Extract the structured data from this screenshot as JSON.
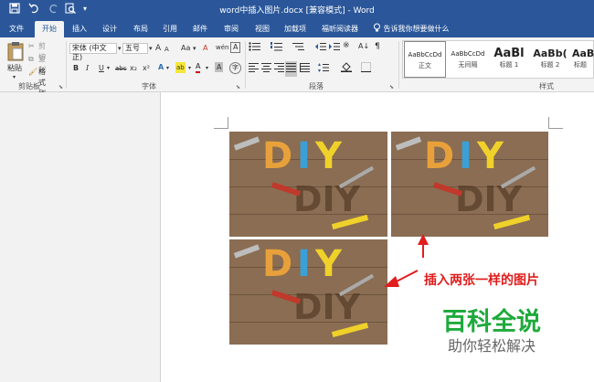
{
  "window": {
    "title": "word中插入图片.docx [兼容模式] - Word",
    "quick_access": [
      "save-icon",
      "undo-icon",
      "redo-icon",
      "print-preview-icon",
      "customize-icon"
    ]
  },
  "tabs": [
    {
      "label": "文件"
    },
    {
      "label": "开始",
      "active": true
    },
    {
      "label": "插入"
    },
    {
      "label": "设计"
    },
    {
      "label": "布局"
    },
    {
      "label": "引用"
    },
    {
      "label": "邮件"
    },
    {
      "label": "审阅"
    },
    {
      "label": "视图"
    },
    {
      "label": "加载项"
    },
    {
      "label": "福昕阅读器"
    }
  ],
  "tell_me": "告诉我你想要做什么",
  "clipboard": {
    "paste": "粘贴",
    "cut": "剪切",
    "copy": "复制",
    "format_painter": "格式刷",
    "label": "剪贴板"
  },
  "font": {
    "name": "宋体 (中文正)",
    "size": "五号",
    "label": "字体",
    "bold": "B",
    "italic": "I",
    "underline": "U",
    "strike": "abc",
    "subscript": "x₂",
    "superscript": "x²",
    "change_case": "Aa",
    "grow": "A",
    "shrink": "A",
    "clear": "A",
    "phonetic": "wén",
    "border_char": "A",
    "effects": "A",
    "highlight": "ab",
    "color": "A",
    "shading": "A",
    "enclose": "字"
  },
  "paragraph": {
    "label": "段落"
  },
  "styles": {
    "label": "样式",
    "items": [
      {
        "preview": "AaBbCcDd",
        "name": "正文",
        "selected": true
      },
      {
        "preview": "AaBbCcDd",
        "name": "无间隔"
      },
      {
        "preview": "AaBl",
        "name": "标题 1"
      },
      {
        "preview": "AaBb(",
        "name": "标题 2"
      },
      {
        "preview": "AaB",
        "name": "标题"
      }
    ]
  },
  "images": {
    "letters_top": "DIY",
    "letters_bottom": "DIY",
    "colors": {
      "d": "#e8a13a",
      "i": "#3aa0d8",
      "y": "#f0d12a",
      "wood": "#8a6d53"
    }
  },
  "annotation": {
    "text": "插入两张一样的图片",
    "color": "#e11d1d"
  },
  "watermark": {
    "main": "百科全说",
    "sub": "助你轻松解决",
    "color": "#1eaa3c"
  }
}
